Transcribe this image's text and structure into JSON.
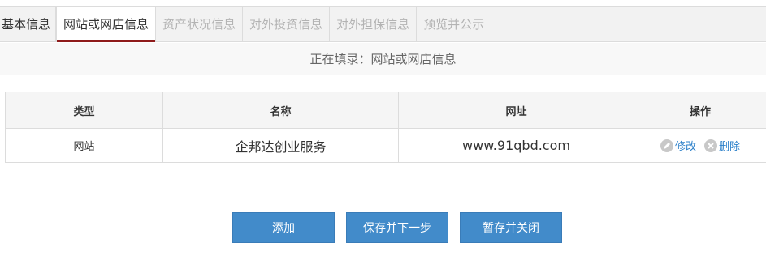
{
  "tabs": [
    {
      "label": "基本信息"
    },
    {
      "label": "网站或网店信息"
    },
    {
      "label": "资产状况信息"
    },
    {
      "label": "对外投资信息"
    },
    {
      "label": "对外担保信息"
    },
    {
      "label": "预览并公示"
    }
  ],
  "status": {
    "text": "正在填录：网站或网店信息"
  },
  "table": {
    "headers": [
      "类型",
      "名称",
      "网址",
      "操作"
    ],
    "rows": [
      {
        "type": "网站",
        "name": "企邦达创业服务",
        "url": "www.91qbd.com",
        "edit_label": "修改",
        "delete_label": "删除"
      }
    ]
  },
  "buttons": {
    "add": "添加",
    "save_next": "保存并下一步",
    "save_close": "暂存并关闭"
  },
  "colors": {
    "active_tab_underline": "#8f1b1b",
    "button_bg": "#428bca",
    "link": "#2a7fc9"
  }
}
